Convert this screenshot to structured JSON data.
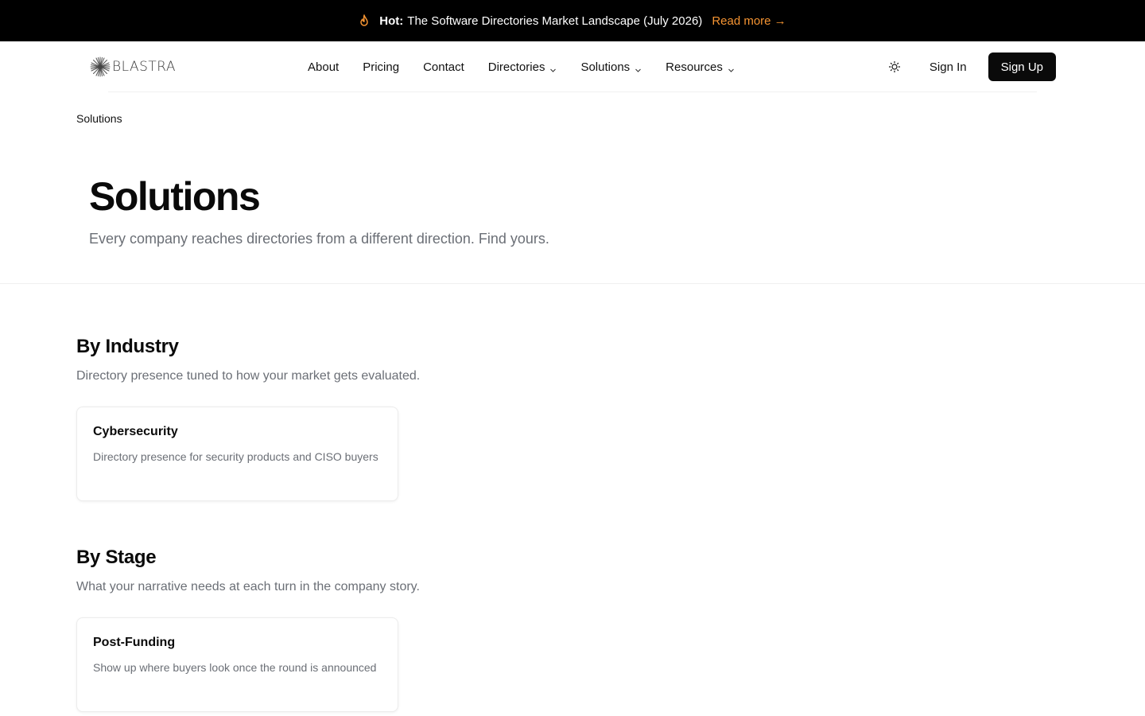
{
  "announcement": {
    "hot_label": "Hot:",
    "message": "The Software Directories Market Landscape (July 2026)",
    "link_label": "Read more →",
    "icon": "flame-icon",
    "link_color": "#f59432"
  },
  "header": {
    "logo_text": "BLASTRA",
    "logo_icon": "starburst-icon",
    "nav": [
      {
        "label": "About",
        "has_dropdown": false
      },
      {
        "label": "Pricing",
        "has_dropdown": false
      },
      {
        "label": "Contact",
        "has_dropdown": false
      },
      {
        "label": "Directories",
        "has_dropdown": true
      },
      {
        "label": "Solutions",
        "has_dropdown": true
      },
      {
        "label": "Resources",
        "has_dropdown": true
      }
    ],
    "theme_icon": "sun-icon",
    "signin_label": "Sign In",
    "signup_label": "Sign Up"
  },
  "breadcrumb": {
    "current": "Solutions"
  },
  "hero": {
    "title": "Solutions",
    "subtitle": "Every company reaches directories from a different direction. Find yours."
  },
  "sections": [
    {
      "title": "By Industry",
      "subtitle": "Directory presence tuned to how your market gets evaluated.",
      "cards": [
        {
          "title": "Cybersecurity",
          "description": "Directory presence for security products and CISO buyers"
        }
      ]
    },
    {
      "title": "By Stage",
      "subtitle": "What your narrative needs at each turn in the company story.",
      "cards": [
        {
          "title": "Post-Funding",
          "description": "Show up where buyers look once the round is announced"
        }
      ]
    }
  ]
}
